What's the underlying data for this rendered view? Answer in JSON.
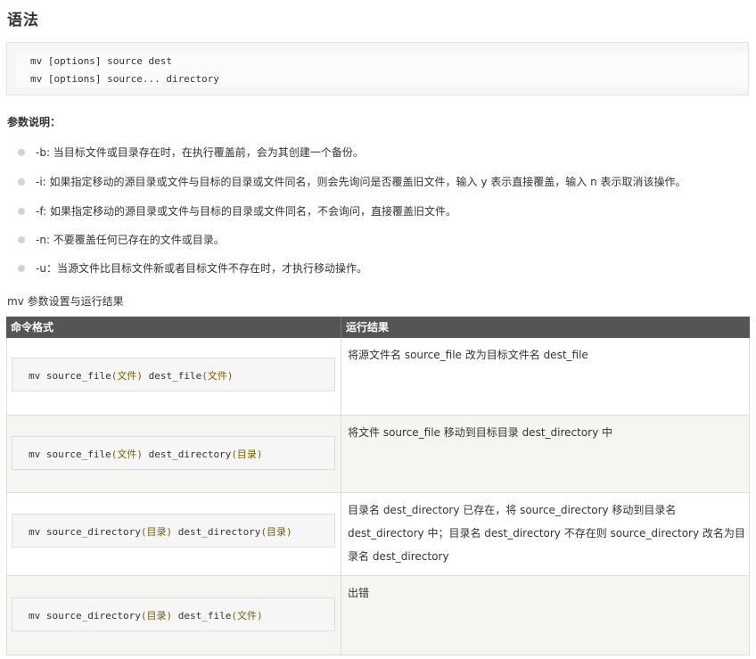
{
  "heading": "语法",
  "syntax": {
    "line1": "mv [options] source dest",
    "line2": "mv [options] source... directory"
  },
  "params_title": "参数说明：",
  "options": [
    {
      "flag": "-b",
      "desc": ": 当目标文件或目录存在时，在执行覆盖前，会为其创建一个备份。"
    },
    {
      "flag": "-i",
      "desc": ": 如果指定移动的源目录或文件与目标的目录或文件同名，则会先询问是否覆盖旧文件，输入 y 表示直接覆盖，输入 n 表示取消该操作。"
    },
    {
      "flag": "-f",
      "desc": ": 如果指定移动的源目录或文件与目标的目录或文件同名，不会询问，直接覆盖旧文件。"
    },
    {
      "flag": "-n",
      "desc": ": 不要覆盖任何已存在的文件或目录。"
    },
    {
      "flag": "-u",
      "desc": "：当源文件比目标文件新或者目标文件不存在时，才执行移动操作。"
    }
  ],
  "table_caption": "mv 参数设置与运行结果",
  "table": {
    "headers": [
      "命令格式",
      "运行结果"
    ],
    "rows": [
      {
        "cmd_a": "mv source_file",
        "paren1": "(文件)",
        "cmd_b": " dest_file",
        "paren2": "(文件)",
        "result": "将源文件名 source_file 改为目标文件名 dest_file"
      },
      {
        "cmd_a": "mv source_file",
        "paren1": "(文件)",
        "cmd_b": " dest_directory",
        "paren2": "(目录)",
        "result": "将文件 source_file 移动到目标目录 dest_directory 中"
      },
      {
        "cmd_a": "mv source_directory",
        "paren1": "(目录)",
        "cmd_b": " dest_directory",
        "paren2": "(目录)",
        "result_lines": [
          "目录名 dest_directory 已存在，将 source_directory 移动到目录名",
          "dest_directory 中；目录名 dest_directory 不存在则 source_directory 改名为目",
          "录名 dest_directory"
        ]
      },
      {
        "cmd_a": "mv source_directory",
        "paren1": "(目录)",
        "cmd_b": " dest_file",
        "paren2": "(文件)",
        "result": "出错"
      }
    ]
  }
}
